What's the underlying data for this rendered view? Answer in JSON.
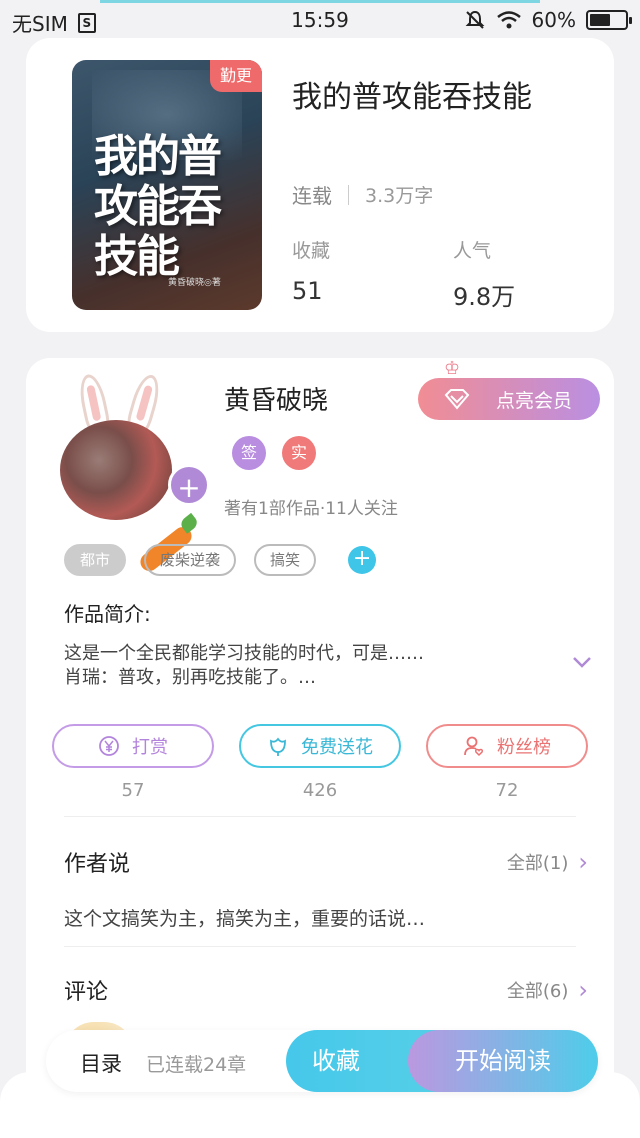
{
  "status_bar": {
    "carrier": "无SIM",
    "sim_icon": "S",
    "time": "15:59",
    "battery": "60%",
    "battery_level": 0.6,
    "icons": [
      "mute-icon",
      "wifi-icon",
      "battery-icon"
    ]
  },
  "book": {
    "cover_badge": "勤更",
    "cover_title": "我的普攻能吞技能",
    "cover_author": "黄昏破晓◎著",
    "title": "我的普攻能吞技能",
    "status": "连载",
    "word_count": "3.3万字",
    "favorites_label": "收藏",
    "favorites_value": "51",
    "popularity_label": "人气",
    "popularity_value": "9.8万"
  },
  "author": {
    "name": "黄昏破晓",
    "badge_sign": "签",
    "badge_real": "实",
    "meta": "著有1部作品·11人关注",
    "vip_button": "点亮会员",
    "follow_plus": "+"
  },
  "tags": [
    "都市",
    "废柴逆袭",
    "搞笑"
  ],
  "intro": {
    "label": "作品简介:",
    "line1": "这是一个全民都能学习技能的时代，可是……",
    "line2": "肖瑞：普攻，别再吃技能了。…"
  },
  "actions": {
    "reward_label": "打赏",
    "reward_count": "57",
    "flower_label": "免费送花",
    "flower_count": "426",
    "fans_label": "粉丝榜",
    "fans_count": "72"
  },
  "author_says": {
    "title": "作者说",
    "link": "全部(1)",
    "text": "这个文搞笑为主，搞笑为主，重要的话说…"
  },
  "comments": {
    "title": "评论",
    "link": "全部(6)"
  },
  "bottom_bar": {
    "toc": "目录",
    "chapters": "已连载24章",
    "favorite": "收藏",
    "start_reading": "开始阅读"
  },
  "colors": {
    "purple": "#b08ad6",
    "cyan": "#45c7e2",
    "coral": "#f07a7a",
    "background": "#f2f2f4"
  }
}
